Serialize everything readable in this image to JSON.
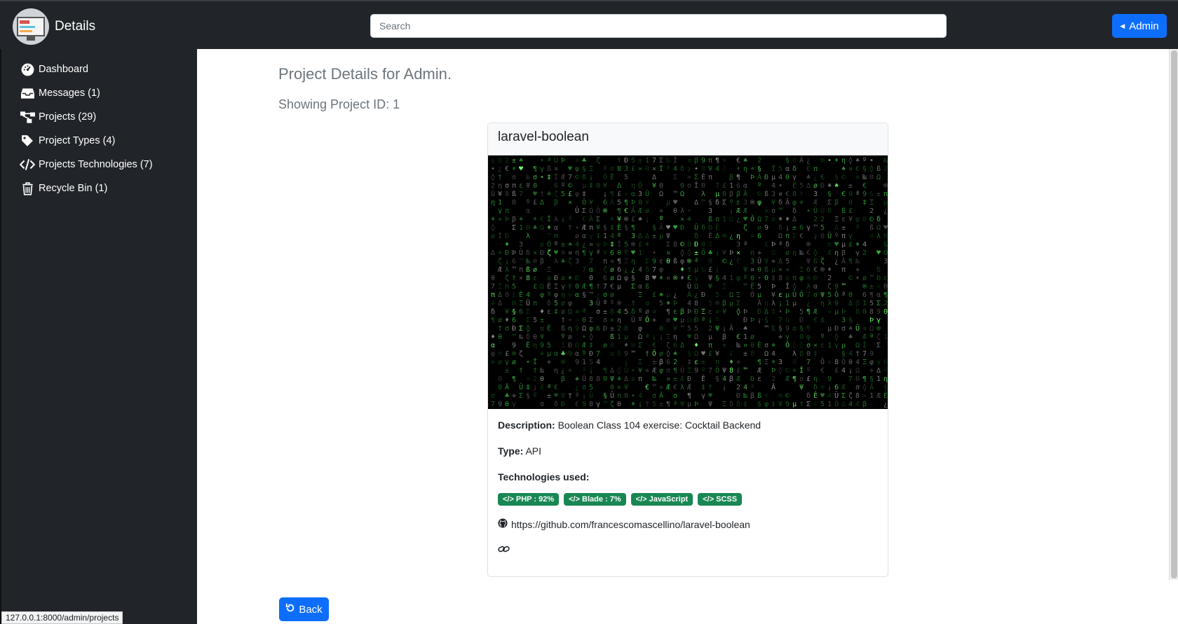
{
  "header": {
    "brand_title": "Details",
    "search_placeholder": "Search",
    "admin_label": "Admin"
  },
  "sidebar": {
    "items": [
      {
        "label": "Dashboard",
        "icon": "dashboard-gauge-icon"
      },
      {
        "label": "Messages (1)",
        "icon": "inbox-icon"
      },
      {
        "label": "Projects (29)",
        "icon": "diagram-icon"
      },
      {
        "label": "Project Types (4)",
        "icon": "tag-icon"
      },
      {
        "label": "Projects Technologies (7)",
        "icon": "code-icon"
      },
      {
        "label": "Recycle Bin (1)",
        "icon": "trash-icon"
      }
    ]
  },
  "main": {
    "title": "Project Details for Admin.",
    "subtitle": "Showing Project ID: 1",
    "card": {
      "title": "laravel-boolean",
      "description_label": "Description:",
      "description": "Boolean Class 104 exercise: Cocktail Backend",
      "type_label": "Type:",
      "type": "API",
      "technologies_label": "Technologies used:",
      "technologies": [
        "PHP : 92%",
        "Blade : 7%",
        "JavaScript",
        "SCSS"
      ],
      "github_url": "https://github.com/francescomascellino/laravel-boolean"
    },
    "back_label": "Back"
  },
  "status_bar": {
    "url": "127.0.0.1:8000/admin/projects"
  },
  "colors": {
    "navbar": "#212529",
    "primary": "#0d6efd",
    "badge": "#198754",
    "muted": "#6c757d"
  }
}
